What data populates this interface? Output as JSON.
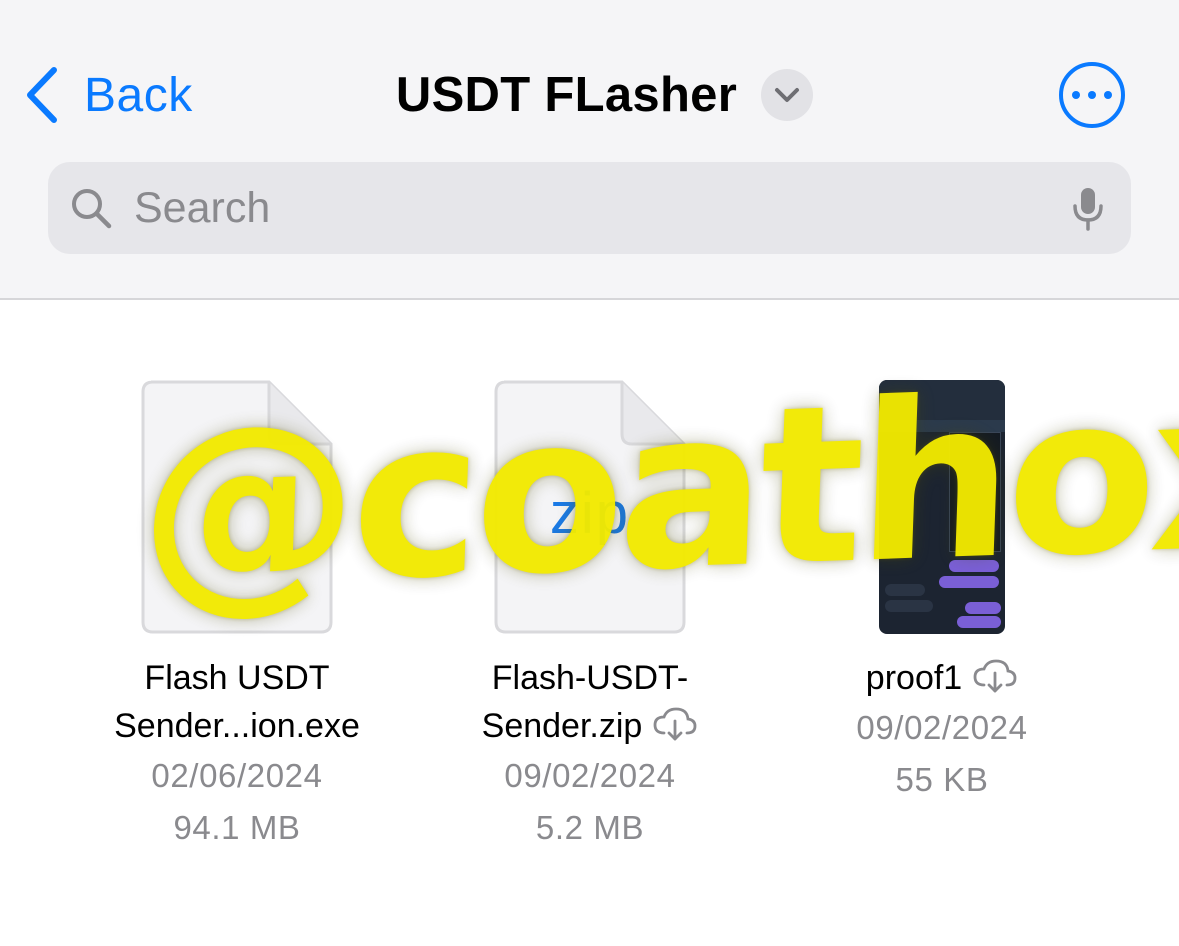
{
  "header": {
    "back_label": "Back",
    "title": "USDT FLasher"
  },
  "search": {
    "placeholder": "Search"
  },
  "files": [
    {
      "name_line1": "Flash USDT",
      "name_line2": "Sender...ion.exe",
      "date": "02/06/2024",
      "size": "94.1 MB",
      "thumbnail": "document-icon",
      "in_cloud": false
    },
    {
      "name_line1": "Flash-USDT-",
      "name_line2": "Sender.zip",
      "date": "09/02/2024",
      "size": "5.2 MB",
      "thumbnail": "zip-document-icon",
      "thumbnail_label": "zip",
      "in_cloud": true
    },
    {
      "name_line1": "proof1",
      "date": "09/02/2024",
      "size": "55 KB",
      "thumbnail": "screenshot-image",
      "in_cloud": true
    }
  ],
  "watermark": "@coathox",
  "colors": {
    "accent": "#0a7aff",
    "header_bg": "#f5f5f7",
    "search_bg": "#e6e6ea",
    "secondary_text": "#8a8a8e",
    "watermark": "#f2ea00"
  }
}
